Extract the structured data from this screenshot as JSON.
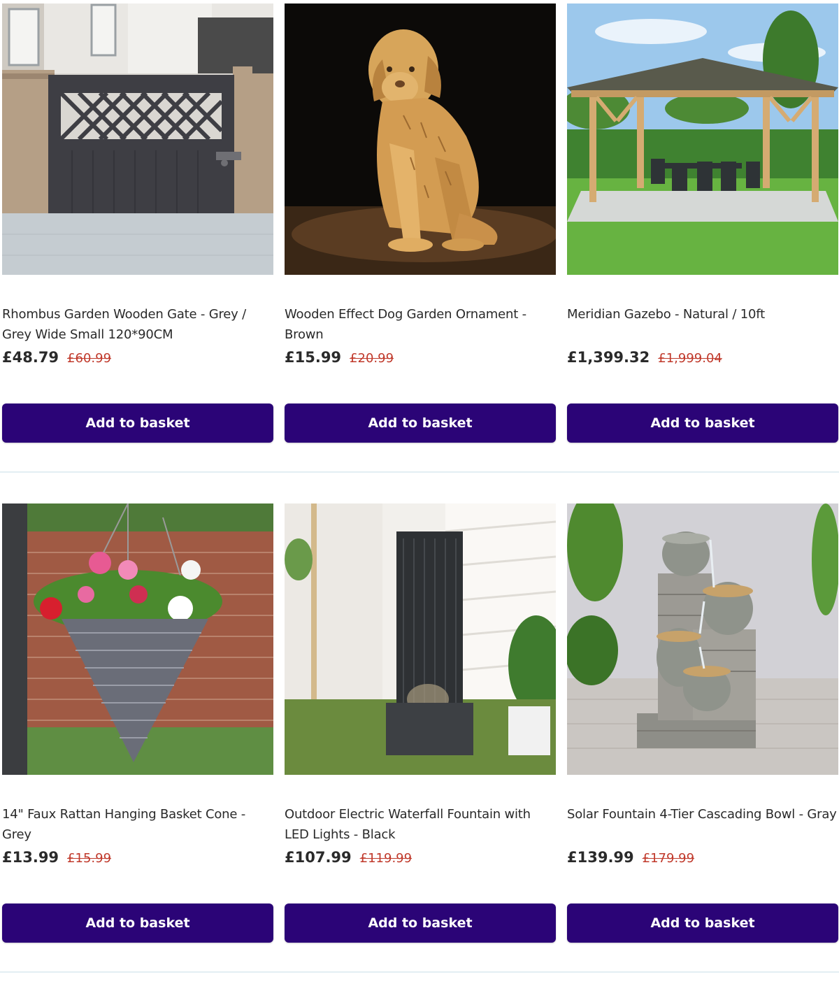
{
  "products": [
    {
      "title": "Rhombus Garden Wooden Gate - Grey / Grey Wide Small 120*90CM",
      "price": "£48.79",
      "was_price": "£60.99",
      "button_label": "Add to basket"
    },
    {
      "title": "Wooden Effect Dog Garden Ornament - Brown",
      "price": "£15.99",
      "was_price": "£20.99",
      "button_label": "Add to basket"
    },
    {
      "title": "Meridian Gazebo - Natural / 10ft",
      "price": "£1,399.32",
      "was_price": "£1,999.04",
      "button_label": "Add to basket"
    },
    {
      "title": "14\" Faux Rattan Hanging Basket Cone - Grey",
      "price": "£13.99",
      "was_price": "£15.99",
      "button_label": "Add to basket"
    },
    {
      "title": "Outdoor Electric Waterfall Fountain with LED Lights - Black",
      "price": "£107.99",
      "was_price": "£119.99",
      "button_label": "Add to basket"
    },
    {
      "title": "Solar Fountain 4-Tier Cascading Bowl - Gray",
      "price": "£139.99",
      "was_price": "£179.99",
      "button_label": "Add to basket"
    }
  ],
  "colors": {
    "button": "#2b0477",
    "sale_price": "#c0392b",
    "divider": "#e3eef3"
  }
}
